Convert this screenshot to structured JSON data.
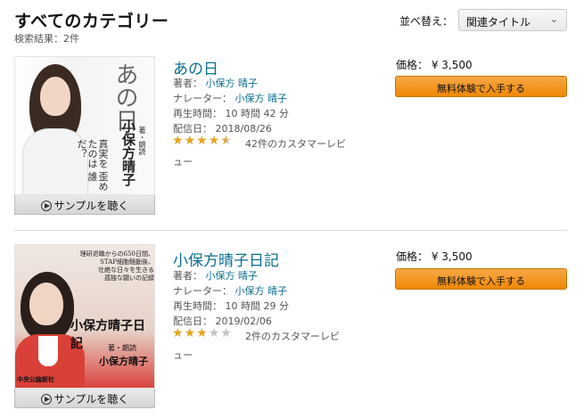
{
  "header": {
    "title": "すべてのカテゴリー",
    "result_count": "検索結果：2件",
    "sort_label": "並べ替え：",
    "sort_value": "関連タイトル"
  },
  "items": [
    {
      "title": "あの日",
      "author_label": "著者：",
      "author": "小保方 晴子",
      "narrator_label": "ナレーター：",
      "narrator": "小保方 晴子",
      "duration": "再生時間： 10 時間 42 分",
      "release": "配信日： 2018/08/26",
      "rating": 4.5,
      "reviews_line1": "42件のカスタマーレビ",
      "reviews_line2": "ュー",
      "price": "価格： ¥ 3,500",
      "buy_label": "無料体験で入手する",
      "sample_label": "サンプルを聴く",
      "cover": {
        "title": "あの日",
        "author_role": "著・朗読",
        "author": "小保方晴子",
        "tagline": "真実を 歪めたのは 誰だ？"
      }
    },
    {
      "title": "小保方晴子日記",
      "author_label": "著者：",
      "author": "小保方 晴子",
      "narrator_label": "ナレーター：",
      "narrator": "小保方 晴子",
      "duration": "再生時間： 10 時間 29 分",
      "release": "配信日： 2019/02/06",
      "rating": 3,
      "reviews_line1": "2件のカスタマーレビ",
      "reviews_line2": "ュー",
      "price": "価格： ¥ 3,500",
      "buy_label": "無料体験で入手する",
      "sample_label": "サンプルを聴く",
      "cover": {
        "title": "小保方晴子日記",
        "author_role": "著・朗読",
        "author": "小保方晴子",
        "blurb1": "理研退職からの650日間、",
        "blurb2": "STAP細胞騒動後、",
        "blurb3": "壮絶な日々を生きる",
        "blurb4": "孤独な闘いの記録",
        "publisher": "中央公論新社"
      }
    }
  ],
  "colors": {
    "link": "#0b6f8f",
    "star": "#e7a21b",
    "buy_button": "#f08804"
  }
}
